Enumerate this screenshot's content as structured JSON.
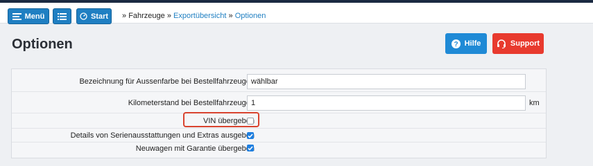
{
  "topbar": {
    "menu_label": "Menü",
    "start_label": "Start",
    "breadcrumb": {
      "prefix": "»",
      "item1": "Fahrzeuge",
      "sep1": "»",
      "item2": "Exportübersicht",
      "sep2": "»",
      "item3": "Optionen"
    }
  },
  "page": {
    "title": "Optionen",
    "help_label": "Hilfe",
    "support_label": "Support"
  },
  "options": {
    "exterior_color": {
      "label": "Bezeichnung für Aussenfarbe bei Bestellfahrzeugen",
      "value": "wählbar"
    },
    "mileage": {
      "label": "Kilometerstand bei Bestellfahrzeugen",
      "value": "1",
      "unit": "km"
    },
    "vin": {
      "label": "VIN übergeben",
      "checked": false
    },
    "series_details": {
      "label": "Details von Serienausstattungen und Extras ausgeben",
      "checked": true
    },
    "warranty": {
      "label": "Neuwagen mit Garantie übergeben",
      "checked": true
    }
  },
  "colors": {
    "accent": "#1f7fc2",
    "help": "#1f8ad6",
    "support": "#e83a2e",
    "highlight": "#d9432f",
    "checkbox": "#1f7fe0"
  }
}
